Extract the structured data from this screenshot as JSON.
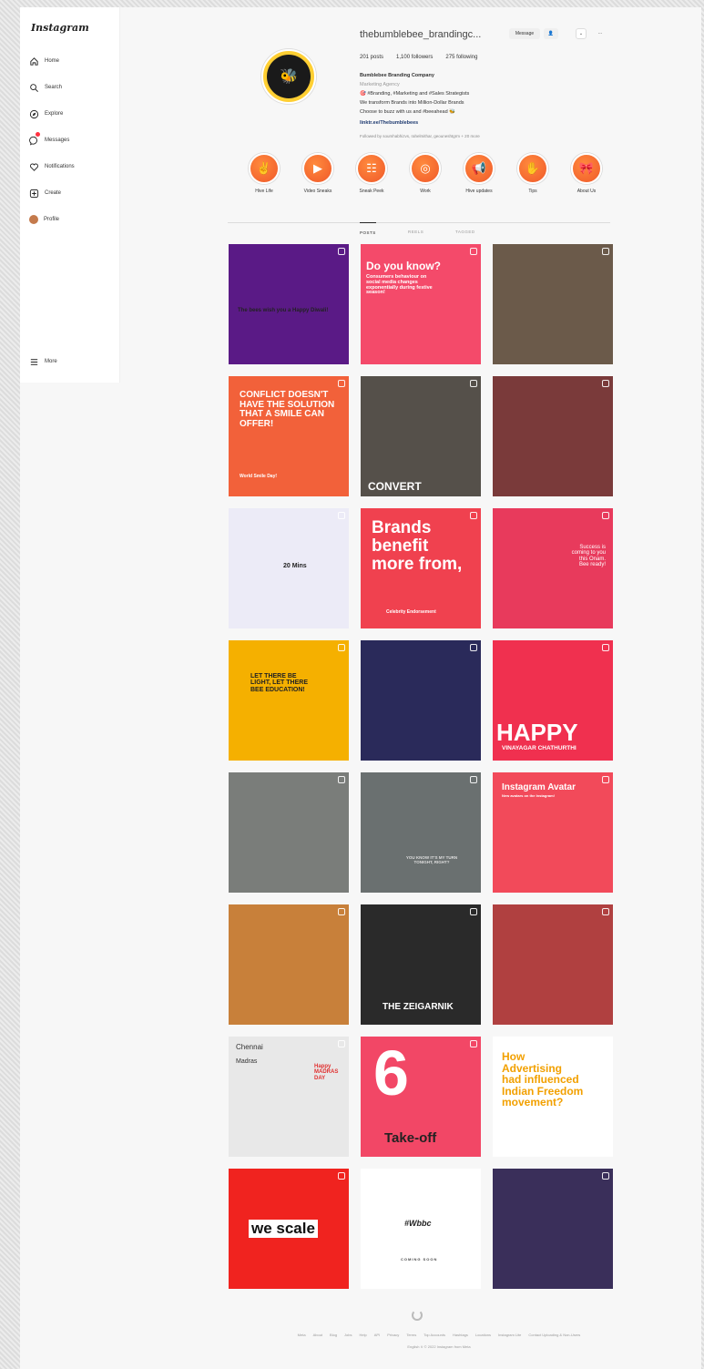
{
  "sidebar": {
    "logo": "Instagram",
    "items": [
      {
        "label": "Home",
        "icon": "home-icon"
      },
      {
        "label": "Search",
        "icon": "search-icon"
      },
      {
        "label": "Explore",
        "icon": "compass-icon"
      },
      {
        "label": "Messages",
        "icon": "messenger-icon"
      },
      {
        "label": "Notifications",
        "icon": "heart-icon"
      },
      {
        "label": "Create",
        "icon": "plus-square-icon"
      },
      {
        "label": "Profile",
        "icon": "avatar-icon"
      }
    ],
    "more": "More"
  },
  "profile": {
    "username": "thebumblebee_brandingc...",
    "message_button": "Message",
    "posts": "201 posts",
    "followers": "1,100 followers",
    "following": "275 following",
    "full_name": "Bumblebee Branding Company",
    "category": "Marketing Agency",
    "bio": [
      "🎯 #Branding, #Marketing and #Sales Strategists",
      "We transform Brands into Million-Dollar Brands",
      "Choose to buzz with us and #beeahead 🐝"
    ],
    "link": "linktr.ee/Thebumblebees",
    "followed_by": "Followed by soumhabhizvs, rahelmithar, geouneshtgrm + 20 more"
  },
  "highlights": [
    {
      "label": "Hive Life",
      "glyph": "✌"
    },
    {
      "label": "Video Sneaks",
      "glyph": "▶"
    },
    {
      "label": "Sneak Peek",
      "glyph": "☷"
    },
    {
      "label": "Work",
      "glyph": "◎"
    },
    {
      "label": "Hive updates",
      "glyph": "📢"
    },
    {
      "label": "Tips",
      "glyph": "✋"
    },
    {
      "label": "About Us",
      "glyph": "🎀"
    }
  ],
  "tabs": [
    "POSTS",
    "REELS",
    "TAGGED"
  ],
  "posts": [
    {
      "text": "The bees wish you a Happy Diwali!",
      "bg": "#5a1a86"
    },
    {
      "text": "Do you know?",
      "sub": "Consumers behaviour on social media changes exponentially during festive season!",
      "bg": "#f44a6a"
    },
    {
      "text": "",
      "bg": "#6b5a4a"
    },
    {
      "text": "CONFLICT DOESN'T HAVE THE SOLUTION THAT A SMILE CAN OFFER!",
      "sub": "World Smile Day!",
      "bg": "#f2613a"
    },
    {
      "text": "CONVERT",
      "bg": "#55504a"
    },
    {
      "text": "",
      "bg": "#7a3a3a"
    },
    {
      "text": "20 Mins",
      "bg": "#ecebf7"
    },
    {
      "text": "Brands benefit more from,",
      "sub": "Celebrity Endorsement",
      "bg": "#f0414f"
    },
    {
      "text": "Success is coming to you this Onam. Bee ready!",
      "bg": "#e83a5c"
    },
    {
      "text": "LET THERE BE LIGHT, LET THERE BEE EDUCATION!",
      "bg": "#f5b000"
    },
    {
      "text": "",
      "bg": "#2a2a5a"
    },
    {
      "text": "HAPPY",
      "sub": "VINAYAGAR CHATHURTHI",
      "bg": "#f0304f"
    },
    {
      "text": "",
      "bg": "#7a7d7a"
    },
    {
      "text": "YOU KNOW IT'S MY TURN TONIGHT, RIGHT?",
      "bg": "#6a7070"
    },
    {
      "text": "Instagram Avatar",
      "sub": "New avatars on the Instagram!",
      "bg": "#f24a5a"
    },
    {
      "text": "",
      "bg": "#c8803a"
    },
    {
      "text": "THE ZEIGARNIK",
      "bg": "#2a2a2a"
    },
    {
      "text": "",
      "bg": "#b04040"
    },
    {
      "text": "Chennai",
      "sub": "Madras",
      "extra": "Happy MADRAS DAY",
      "bg": "#e8e8e8"
    },
    {
      "text": "6",
      "sub": "Take-off",
      "bg": "#f24766"
    },
    {
      "text": "How Advertising had influenced Indian Freedom movement?",
      "bg": "#ffffff"
    },
    {
      "text": "we scale",
      "bg": "#f0231f"
    },
    {
      "text": "#Wbbc",
      "sub": "COMING SOON",
      "bg": "#ffffff"
    },
    {
      "text": "",
      "bg": "#3a2f5a"
    }
  ],
  "footer": {
    "links": [
      "Meta",
      "About",
      "Blog",
      "Jobs",
      "Help",
      "API",
      "Privacy",
      "Terms",
      "Top Accounts",
      "Hashtags",
      "Locations",
      "Instagram Lite",
      "Contact Uploading & Non-Users"
    ],
    "copyright": "English ∨   © 2022 Instagram from Meta"
  }
}
